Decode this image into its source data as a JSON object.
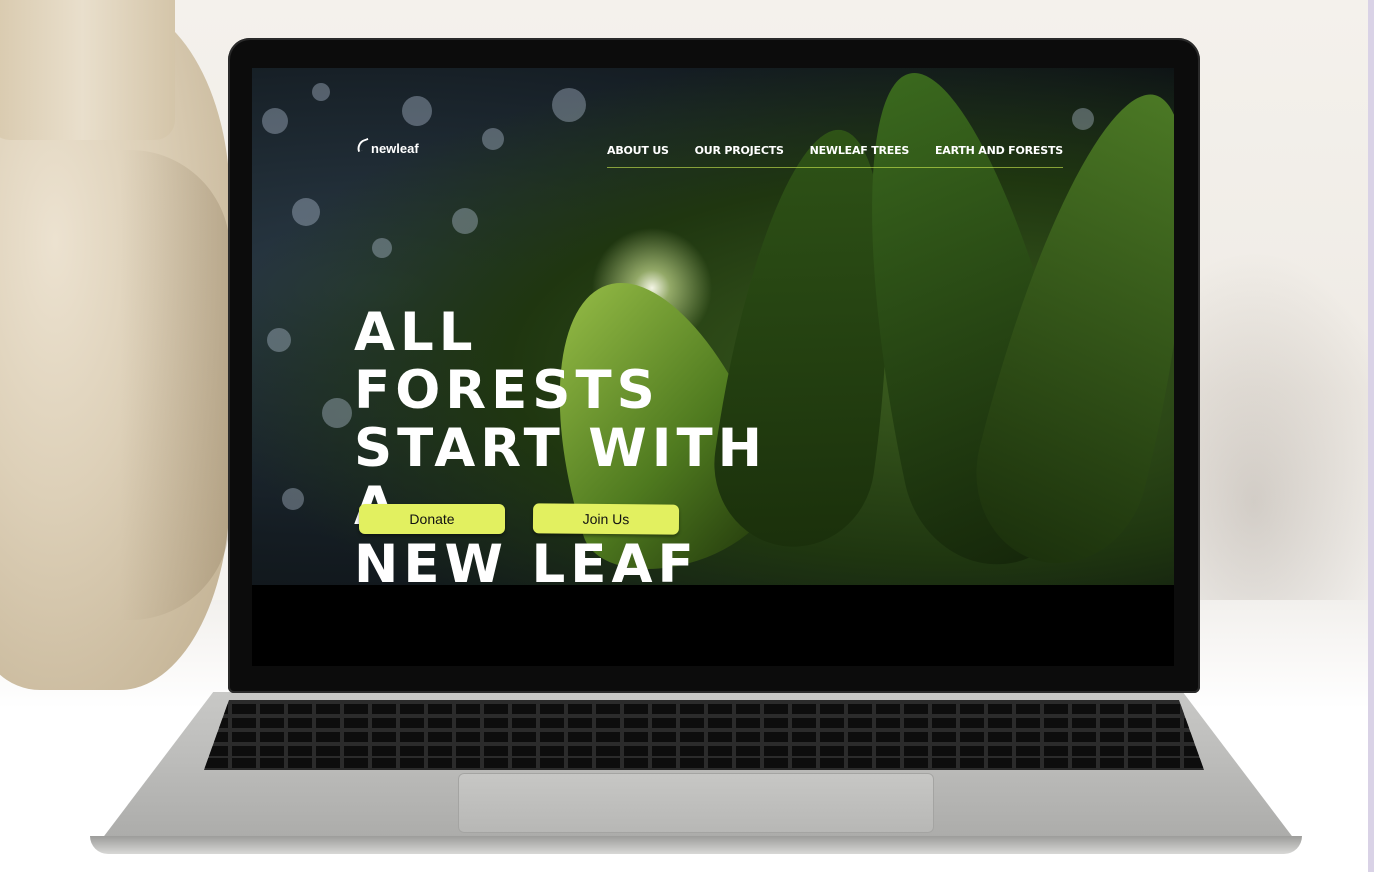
{
  "site": {
    "logo_text": "newleaf",
    "nav": [
      {
        "label": "ABOUT US"
      },
      {
        "label": "OUR PROJECTS"
      },
      {
        "label": "NEWLEAF TREES"
      },
      {
        "label": "EARTH AND FORESTS"
      }
    ],
    "headline_lines": [
      "ALL FORESTS",
      "START WITH A",
      "NEW LEAF"
    ],
    "buttons": {
      "donate": "Donate",
      "join": "Join Us"
    },
    "colors": {
      "accent": "#e2f060",
      "text": "#ffffff",
      "screen_bg": "#000000"
    }
  }
}
